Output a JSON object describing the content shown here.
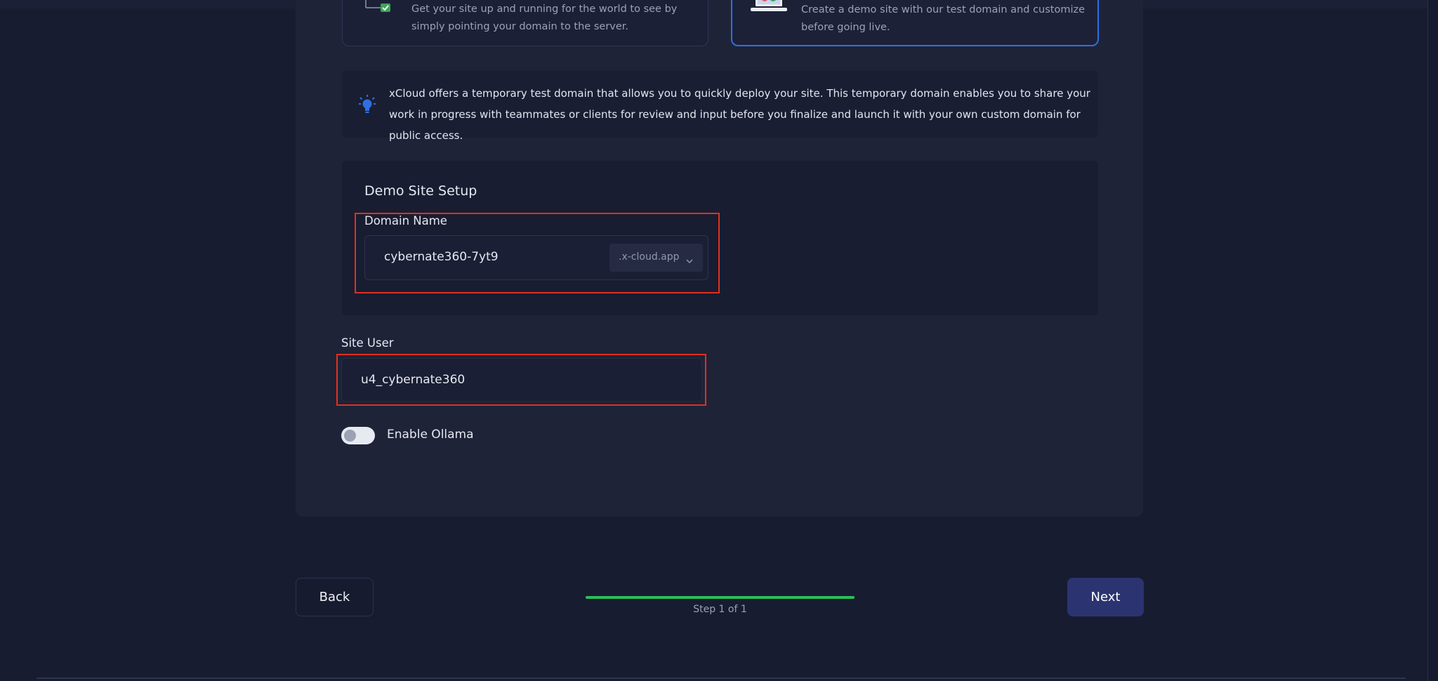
{
  "options": {
    "live_site": {
      "description": "Get your site up and running for the world to see by simply pointing your domain to the server."
    },
    "demo_site": {
      "description": "Create a demo site with our test domain and customize before going live.",
      "selected": true
    }
  },
  "info": {
    "text": "xCloud offers a temporary test domain that allows you to quickly deploy your site. This temporary domain enables you to share your work in progress with teammates or clients for review and input before you finalize and launch it with your own custom domain for public access."
  },
  "demo_setup": {
    "title": "Demo Site Setup",
    "domain_label": "Domain Name",
    "domain_value": "cybernate360-7yt9",
    "domain_suffix": ".x-cloud.app"
  },
  "site_user": {
    "label": "Site User",
    "value": "u4_cybernate360"
  },
  "ollama": {
    "label": "Enable Ollama",
    "enabled": false
  },
  "footer": {
    "back_label": "Back",
    "next_label": "Next",
    "step_text": "Step 1 of 1",
    "progress": 1.0
  },
  "colors": {
    "accent": "#2f6fe0",
    "progress": "#2bbf5a",
    "highlight": "#e0301e",
    "next_button": "#2b3470"
  }
}
